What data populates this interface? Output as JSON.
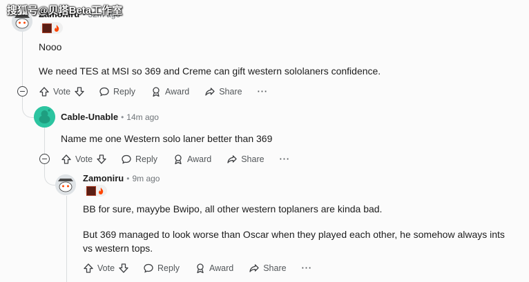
{
  "watermark": "搜狐号@贝塔Beta工作室",
  "comments": [
    {
      "author": "Zamoniru",
      "time": "32m ago",
      "paragraphs": [
        "Nooo",
        "We need TES at MSI so 369 and Creme can gift western sololaners confidence."
      ]
    },
    {
      "author": "Cable-Unable",
      "time": "14m ago",
      "paragraphs": [
        "Name me one Western solo laner better than 369"
      ]
    },
    {
      "author": "Zamoniru",
      "time": "9m ago",
      "paragraphs": [
        "BB for sure, mayybe Bwipo, all other western toplaners are kinda bad.",
        "But 369 managed to look worse than Oscar when they played each other, he somehow always ints",
        "vs western tops."
      ]
    }
  ],
  "actions": {
    "vote": "Vote",
    "reply": "Reply",
    "award": "Award",
    "share": "Share",
    "more": "···"
  },
  "colors": {
    "avatar_green": "#2cc4a0",
    "thread_line": "#d9dcde",
    "text": "#1c1c1c",
    "meta": "#6f7478"
  }
}
